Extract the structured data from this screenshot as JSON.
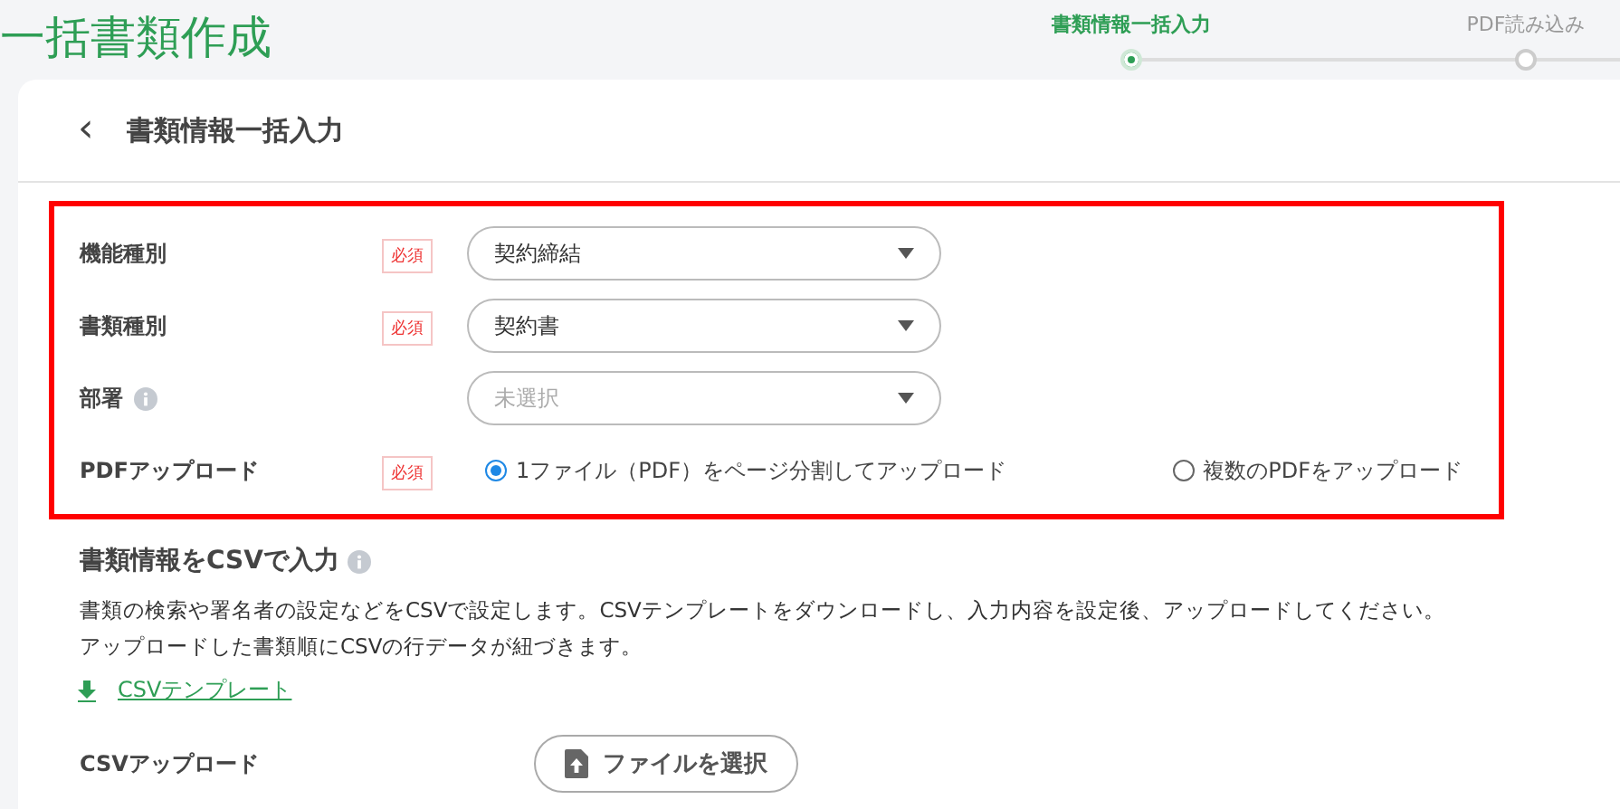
{
  "page_title": "一括書類作成",
  "steps": [
    {
      "label": "書類情報一括入力",
      "selected": true
    },
    {
      "label": "PDF読み込み",
      "selected": false
    }
  ],
  "card": {
    "back_icon": "‹",
    "title": "書類情報一括入力"
  },
  "form": {
    "rows": [
      {
        "kind": "select",
        "label": "機能種別",
        "info": false,
        "required": "必須",
        "value": "契約締結"
      },
      {
        "kind": "select",
        "label": "書類種別",
        "info": false,
        "required": "必須",
        "value": "契約書"
      },
      {
        "kind": "select",
        "label": "部署",
        "info": true,
        "placeholder": "未選択"
      },
      {
        "kind": "radio",
        "label": "PDFアップロード",
        "info": false,
        "required": "必須",
        "options": [
          {
            "label": "1ファイル（PDF）をページ分割してアップロード",
            "selected": true
          },
          {
            "label": "複数のPDFをアップロード",
            "selected": false
          }
        ]
      }
    ]
  },
  "csv_section": {
    "title": "書類情報をCSVで入力",
    "info": true,
    "description": [
      "書類の検索や署名者の設定などをCSVで設定します。CSVテンプレートをダウンロードし、入力内容を設定後、アップロードしてください。",
      "アップロードした書類順にCSVの行データが紐づきます。"
    ],
    "template_link": "CSVテンプレート",
    "upload_label": "CSVアップロード",
    "upload_button": "ファイルを選択"
  }
}
